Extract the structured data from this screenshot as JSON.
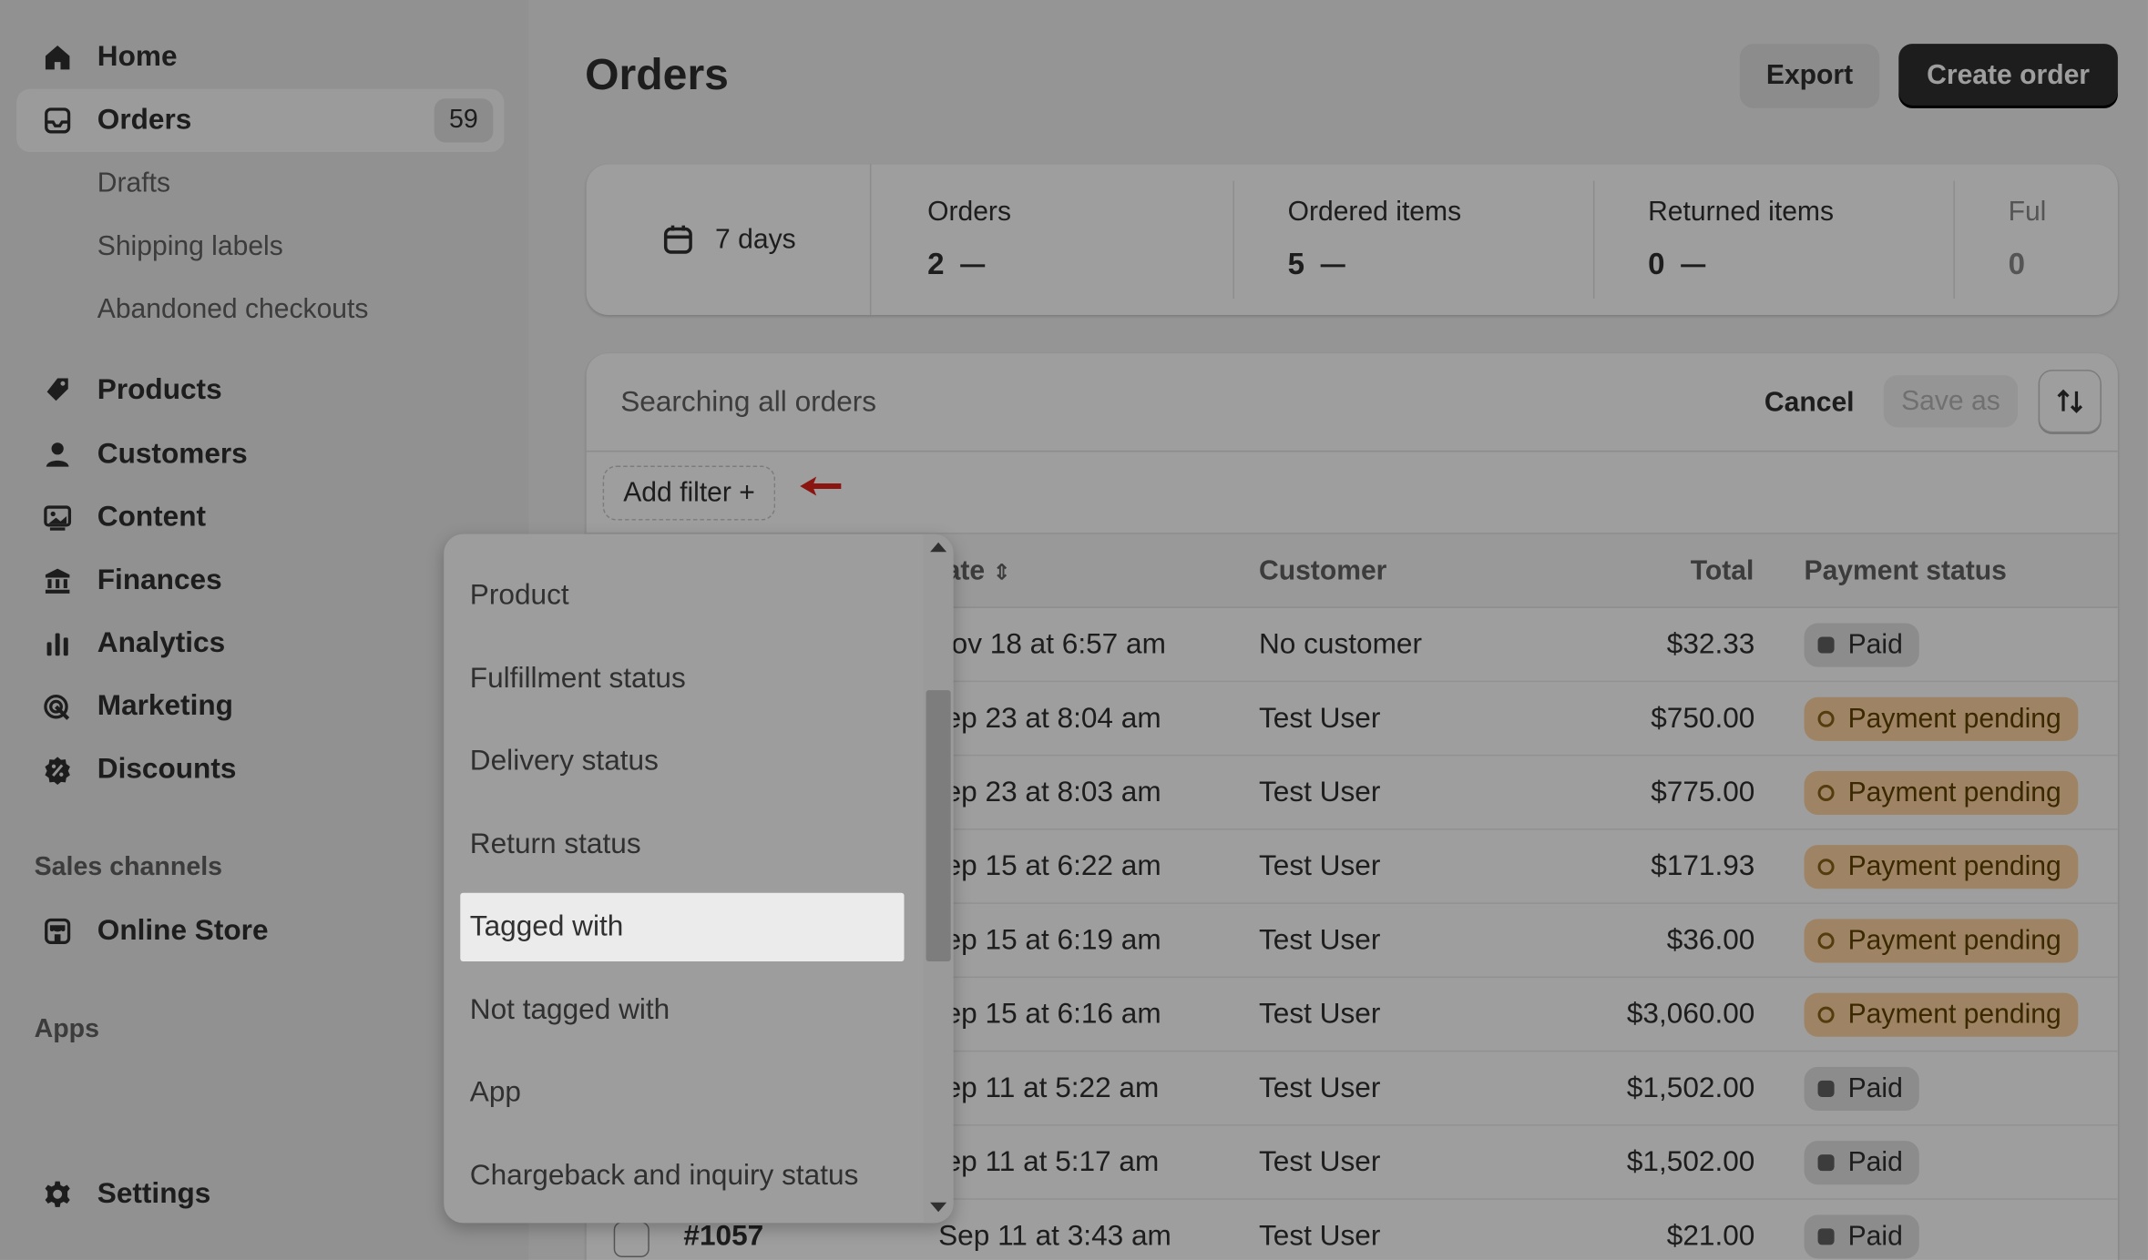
{
  "sidebar": {
    "items": [
      {
        "label": "Home",
        "icon": "home-icon"
      },
      {
        "label": "Orders",
        "icon": "inbox-icon",
        "badge": "59",
        "active": true
      },
      {
        "label": "Products",
        "icon": "tag-icon"
      },
      {
        "label": "Customers",
        "icon": "person-icon"
      },
      {
        "label": "Content",
        "icon": "image-icon"
      },
      {
        "label": "Finances",
        "icon": "bank-icon"
      },
      {
        "label": "Analytics",
        "icon": "bar-chart-icon"
      },
      {
        "label": "Marketing",
        "icon": "target-icon"
      },
      {
        "label": "Discounts",
        "icon": "discount-icon"
      }
    ],
    "orders_sub": [
      "Drafts",
      "Shipping labels",
      "Abandoned checkouts"
    ],
    "sales_channels_title": "Sales channels",
    "online_store": "Online Store",
    "apps_title": "Apps",
    "settings": "Settings"
  },
  "header": {
    "title": "Orders",
    "export_label": "Export",
    "create_label": "Create order"
  },
  "stats": {
    "range": "7 days",
    "items": [
      {
        "label": "Orders",
        "value": "2"
      },
      {
        "label": "Ordered items",
        "value": "5"
      },
      {
        "label": "Returned items",
        "value": "0"
      },
      {
        "label": "Ful",
        "value": "0"
      }
    ]
  },
  "search": {
    "placeholder": "Searching all orders",
    "cancel_label": "Cancel",
    "save_as_label": "Save as",
    "add_filter_label": "Add filter +"
  },
  "table": {
    "columns": {
      "date": "ate",
      "customer": "Customer",
      "total": "Total",
      "payment_status": "Payment status"
    },
    "rows": [
      {
        "order": "",
        "date": "lov 18 at 6:57 am",
        "customer": "No customer",
        "total": "$32.33",
        "status": "Paid"
      },
      {
        "order": "",
        "date": "ep 23 at 8:04 am",
        "customer": "Test User",
        "total": "$750.00",
        "status": "Payment pending"
      },
      {
        "order": "",
        "date": "ep 23 at 8:03 am",
        "customer": "Test User",
        "total": "$775.00",
        "status": "Payment pending"
      },
      {
        "order": "",
        "date": "ep 15 at 6:22 am",
        "customer": "Test User",
        "total": "$171.93",
        "status": "Payment pending"
      },
      {
        "order": "",
        "date": "ep 15 at 6:19 am",
        "customer": "Test User",
        "total": "$36.00",
        "status": "Payment pending"
      },
      {
        "order": "",
        "date": "ep 15 at 6:16 am",
        "customer": "Test User",
        "total": "$3,060.00",
        "status": "Payment pending"
      },
      {
        "order": "",
        "date": "ep 11 at 5:22 am",
        "customer": "Test User",
        "total": "$1,502.00",
        "status": "Paid"
      },
      {
        "order": "",
        "date": "ep 11 at 5:17 am",
        "customer": "Test User",
        "total": "$1,502.00",
        "status": "Paid"
      },
      {
        "order": "#1057",
        "date": "Sep 11 at 3:43 am",
        "customer": "Test User",
        "total": "$21.00",
        "status": "Paid"
      }
    ]
  },
  "dropdown": {
    "items": [
      "Product",
      "Fulfillment status",
      "Delivery status",
      "Return status",
      "Tagged with",
      "Not tagged with",
      "App",
      "Chargeback and inquiry status"
    ],
    "highlighted": "Tagged with"
  },
  "colors": {
    "primary_button": "#303030",
    "pending_badge": "#ffd6a4",
    "paid_badge": "#e3e3e3",
    "annotation_arrow": "#e0241c"
  }
}
